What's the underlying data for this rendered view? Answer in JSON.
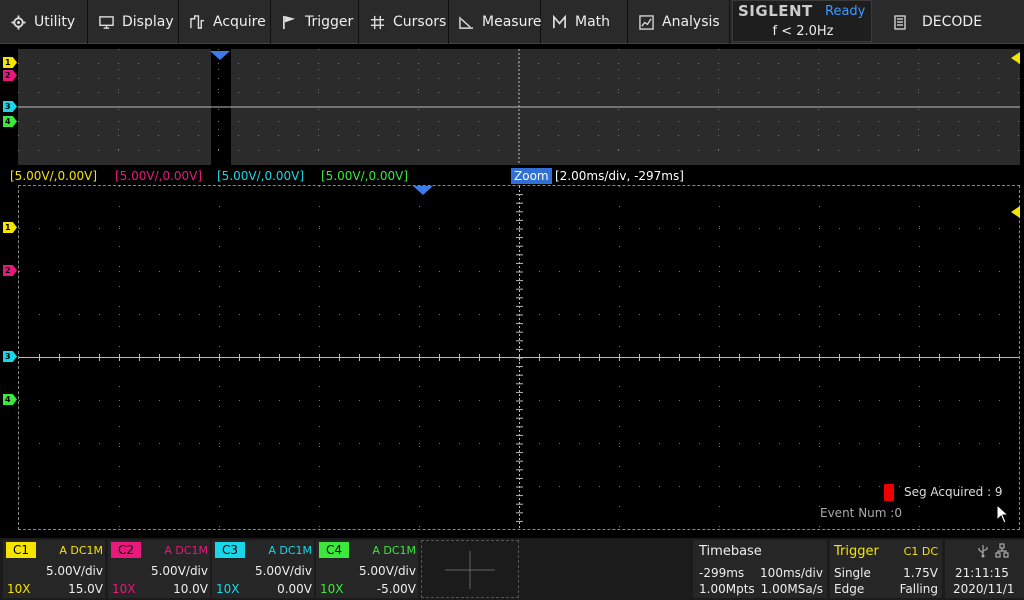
{
  "menu": [
    {
      "label": "Utility",
      "icon": "gear-icon"
    },
    {
      "label": "Display",
      "icon": "monitor-icon"
    },
    {
      "label": "Acquire",
      "icon": "acquire-icon"
    },
    {
      "label": "Trigger",
      "icon": "flag-icon"
    },
    {
      "label": "Cursors",
      "icon": "crosshair-icon"
    },
    {
      "label": "Measure",
      "icon": "measure-icon"
    },
    {
      "label": "Math",
      "icon": "math-icon"
    },
    {
      "label": "Analysis",
      "icon": "analysis-icon"
    }
  ],
  "brand": {
    "name": "SIGLENT",
    "status": "Ready",
    "freq": "f < 2.0Hz"
  },
  "decode": {
    "label": "DECODE",
    "icon": "decode-icon"
  },
  "scales": [
    {
      "text": "[5.00V/,0.00V]",
      "color": "#f5e400"
    },
    {
      "text": "[5.00V/,0.00V]",
      "color": "#e8197d"
    },
    {
      "text": "[5.00V/,0.00V]",
      "color": "#19d7e8"
    },
    {
      "text": "[5.00V/,0.00V]",
      "color": "#3be83b"
    }
  ],
  "zoom": {
    "tag": "Zoom",
    "info": "[2.00ms/div, -297ms]"
  },
  "markers": [
    {
      "label": "1",
      "color": "#f5e400"
    },
    {
      "label": "2",
      "color": "#e8197d"
    },
    {
      "label": "3",
      "color": "#19d7e8"
    },
    {
      "label": "4",
      "color": "#3be83b"
    }
  ],
  "seg": {
    "acquired": "Seg Acquired : 9",
    "event": "Event Num :0"
  },
  "channels": [
    {
      "tag": "C1",
      "coupling": "A DC1M",
      "vdiv": "5.00V/div",
      "probe": "10X",
      "offset": "15.0V",
      "color": "#f5e400"
    },
    {
      "tag": "C2",
      "coupling": "A DC1M",
      "vdiv": "5.00V/div",
      "probe": "10X",
      "offset": "10.0V",
      "color": "#e8197d"
    },
    {
      "tag": "C3",
      "coupling": "A DC1M",
      "vdiv": "5.00V/div",
      "probe": "10X",
      "offset": "0.00V",
      "color": "#19d7e8"
    },
    {
      "tag": "C4",
      "coupling": "A DC1M",
      "vdiv": "5.00V/div",
      "probe": "10X",
      "offset": "-5.00V",
      "color": "#3be83b"
    }
  ],
  "timebase": {
    "title": "Timebase",
    "delay": "-299ms",
    "tdiv": "100ms/div",
    "mpts": "1.00Mpts",
    "srate": "1.00MSa/s"
  },
  "trigger": {
    "title": "Trigger",
    "source": "C1 DC",
    "mode": "Single",
    "level": "1.75V",
    "type": "Edge",
    "slope": "Falling"
  },
  "system": {
    "time": "21:11:15",
    "date": "2020/11/1",
    "usb_icon": "usb-icon",
    "network_icon": "network-icon"
  }
}
